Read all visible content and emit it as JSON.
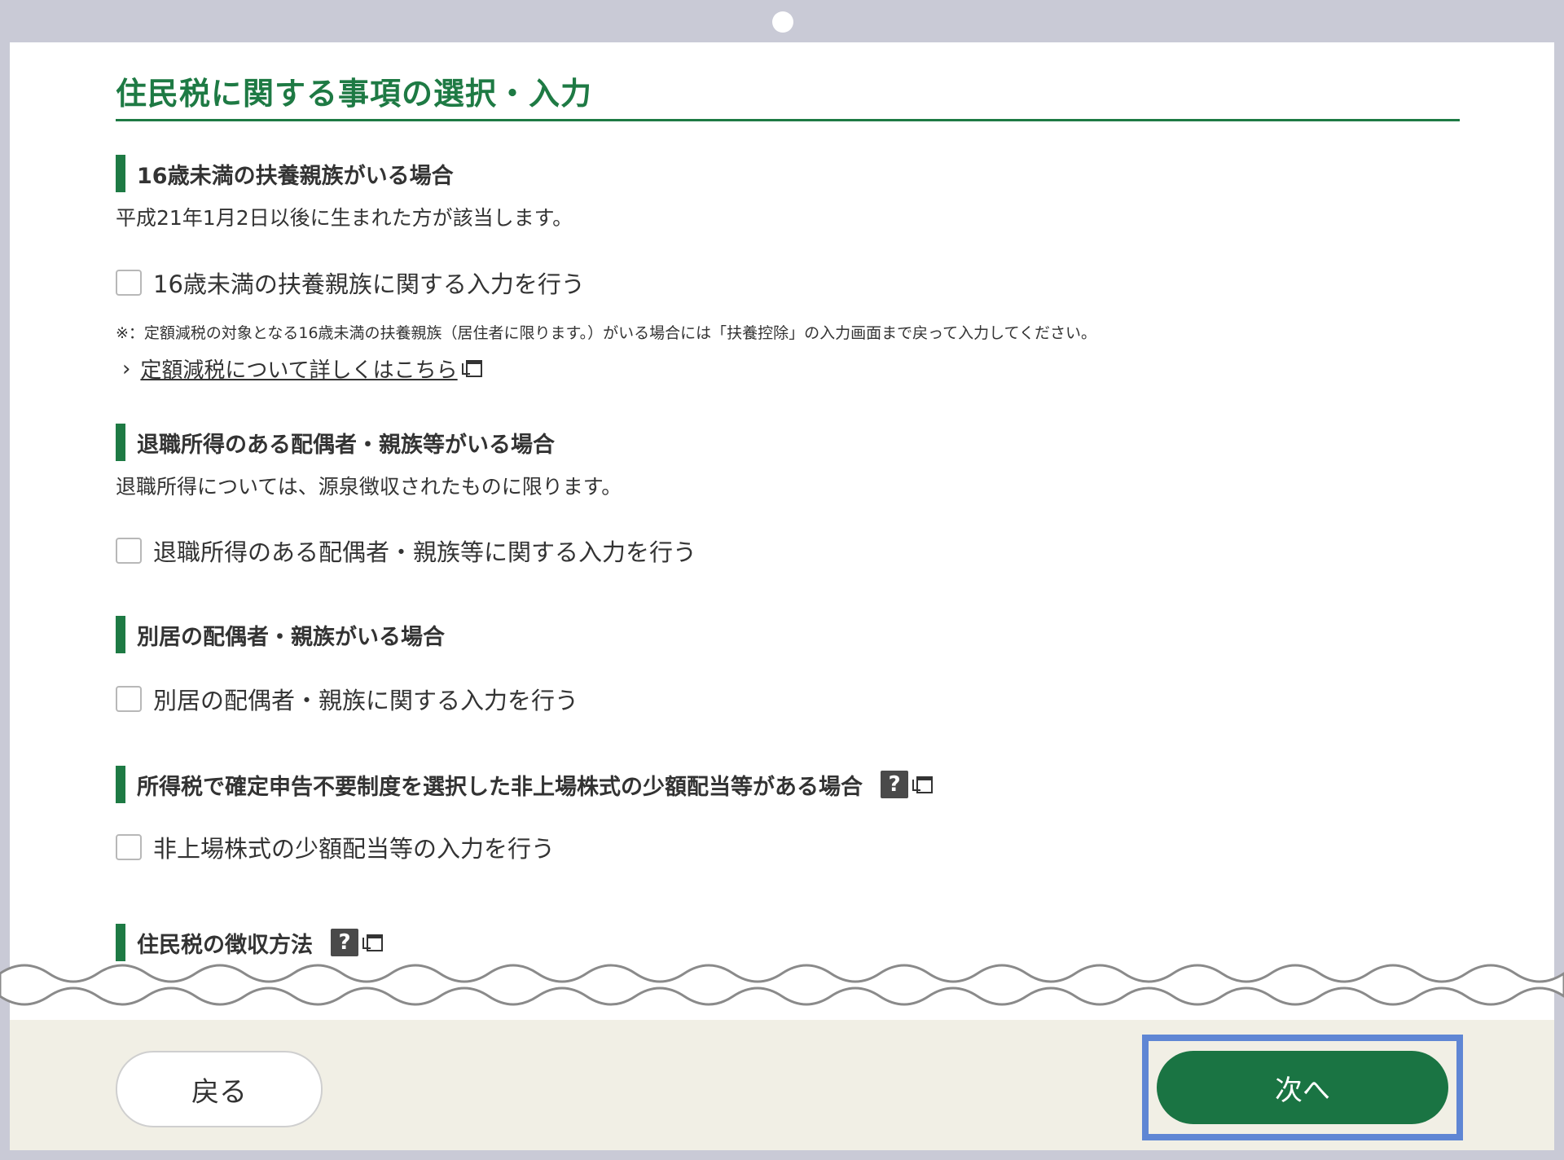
{
  "page_title": "住民税に関する事項の選択・入力",
  "sections": [
    {
      "heading": "16歳未満の扶養親族がいる場合",
      "description": "平成21年1月2日以後に生まれた方が該当します。",
      "checkbox_label": "16歳未満の扶養親族に関する入力を行う",
      "checked": false,
      "note": "※：定額減税の対象となる16歳未満の扶養親族（居住者に限ります。）がいる場合には「扶養控除」の入力画面まで戻って入力してください。",
      "link_text": "定額減税について詳しくはこちら"
    },
    {
      "heading": "退職所得のある配偶者・親族等がいる場合",
      "description": "退職所得については、源泉徴収されたものに限ります。",
      "checkbox_label": "退職所得のある配偶者・親族等に関する入力を行う",
      "checked": false
    },
    {
      "heading": "別居の配偶者・親族がいる場合",
      "checkbox_label": "別居の配偶者・親族に関する入力を行う",
      "checked": false
    },
    {
      "heading": "所得税で確定申告不要制度を選択した非上場株式の少額配当等がある場合",
      "checkbox_label": "非上場株式の少額配当等の入力を行う",
      "checked": false
    },
    {
      "heading": "住民税の徴収方法"
    }
  ],
  "help_icon_glyph": "?",
  "footer": {
    "back_label": "戻る",
    "next_label": "次へ"
  },
  "colors": {
    "accent": "#1e7a44",
    "next_button": "#1a7443",
    "focus_ring": "#5f86d4",
    "footer_bg": "#f1efe5",
    "frame": "#c9cad6"
  }
}
